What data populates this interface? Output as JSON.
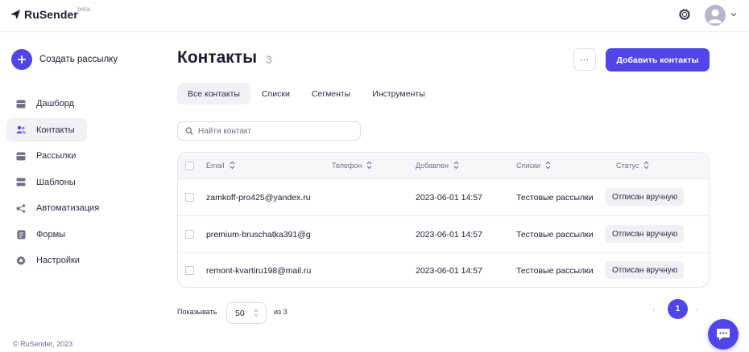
{
  "brand": {
    "name": "RuSender",
    "badge": "beta",
    "accent": "#4f46e5"
  },
  "header": {
    "status_icon": "status-ring-icon",
    "avatar_icon": "user-avatar",
    "menu_icon": "chevron-down-icon"
  },
  "sidebar": {
    "create_label": "Создать рассылку",
    "items": [
      {
        "label": "Дашборд",
        "icon": "dashboard-icon",
        "active": false
      },
      {
        "label": "Контакты",
        "icon": "contacts-icon",
        "active": true
      },
      {
        "label": "Рассылки",
        "icon": "mailings-icon",
        "active": false
      },
      {
        "label": "Шаблоны",
        "icon": "templates-icon",
        "active": false
      },
      {
        "label": "Автоматизация",
        "icon": "automation-icon",
        "active": false
      },
      {
        "label": "Формы",
        "icon": "forms-icon",
        "active": false
      },
      {
        "label": "Настройки",
        "icon": "settings-icon",
        "active": false
      }
    ],
    "footer": "© RuSender, 2023"
  },
  "main": {
    "title": "Контакты",
    "count": "3",
    "more_label": "···",
    "add_label": "Добавить контакты",
    "tabs": [
      {
        "label": "Все контакты",
        "active": true
      },
      {
        "label": "Списки",
        "active": false
      },
      {
        "label": "Сегменты",
        "active": false
      },
      {
        "label": "Инструменты",
        "active": false
      }
    ],
    "search": {
      "placeholder": "Найти контакт",
      "value": ""
    },
    "table": {
      "columns": [
        "Email",
        "Телефон",
        "Добавлен",
        "Списки",
        "Статус"
      ],
      "rows": [
        {
          "email": "zamkoff-pro425@yandex.ru",
          "phone": "",
          "added": "2023-06-01 14:57",
          "lists": "Тестовые рассылки",
          "status": "Отписан вручную"
        },
        {
          "email": "premium-bruschatka391@g",
          "phone": "",
          "added": "2023-06-01 14:57",
          "lists": "Тестовые рассылки",
          "status": "Отписан вручную"
        },
        {
          "email": "remont-kvartiru198@mail.ru",
          "phone": "",
          "added": "2023-06-01 14:57",
          "lists": "Тестовые рассылки",
          "status": "Отписан вручную"
        }
      ]
    },
    "pagination": {
      "show_label": "Показывать",
      "per_page": "50",
      "of_label": "из 3",
      "prev": "‹",
      "current": "1",
      "next": "›"
    }
  },
  "chat": {
    "icon": "chat-bubble-icon"
  }
}
